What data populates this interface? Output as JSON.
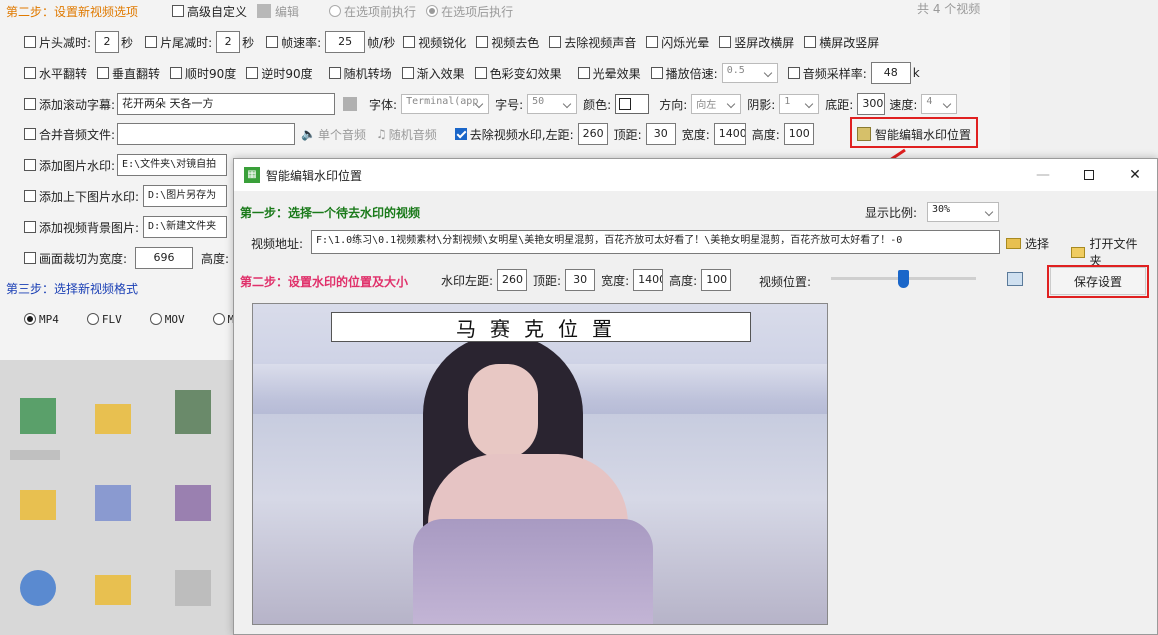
{
  "back": {
    "step2_title": "第二步：设置新视频选项",
    "advanced_custom": "高级自定义",
    "edit_label": "编辑",
    "before_opt": "在选项前执行",
    "after_opt": "在选项后执行",
    "count_text": "共 4 个视频",
    "row1": {
      "head_cut": "片头减时:",
      "head_val": "2",
      "sec1": "秒",
      "tail_cut": "片尾减时:",
      "tail_val": "2",
      "sec2": "秒",
      "fps": "帧速率:",
      "fps_val": "25",
      "fps_unit": "帧/秒",
      "sharpen": "视频锐化",
      "decolor": "视频去色",
      "mute": "去除视频声音",
      "flash": "闪烁光晕",
      "v2h": "竖屏改横屏",
      "h2v": "横屏改竖屏"
    },
    "row2": {
      "hflip": "水平翻转",
      "vflip": "垂直翻转",
      "cw90": "顺时90度",
      "ccw90": "逆时90度",
      "random_trans": "随机转场",
      "fade_in": "渐入效果",
      "color_fx": "色彩变幻效果",
      "halo_fx": "光晕效果",
      "speed": "播放倍速:",
      "speed_val": "0.5",
      "sample_rate": "音频采样率:",
      "sample_val": "48",
      "sample_unit": "k"
    },
    "row3": {
      "scroll_sub": "添加滚动字幕:",
      "sub_text": "花开两朵 天各一方",
      "font_lbl": "字体:",
      "font_val": "Terminal(app",
      "size_lbl": "字号:",
      "size_val": "50",
      "color_lbl": "颜色:",
      "dir_lbl": "方向:",
      "dir_val": "向左",
      "shadow_lbl": "阴影:",
      "shadow_val": "1",
      "bottom_lbl": "底距:",
      "bottom_val": "300",
      "speed_lbl": "速度:",
      "speed_val": "4"
    },
    "row4": {
      "merge_audio": "合并音频文件:",
      "single_audio": "单个音频",
      "random_audio": "随机音频",
      "remove_wm": "去除视频水印,左距:",
      "left_val": "260",
      "top_lbl": "顶距:",
      "top_val": "30",
      "width_lbl": "宽度:",
      "width_val": "1400",
      "height_lbl": "高度:",
      "height_val": "100",
      "smart_btn": "智能编辑水印位置"
    },
    "row5": {
      "img_wm": "添加图片水印:",
      "path": "E:\\文件夹\\对镜自拍"
    },
    "row6": {
      "tb_wm": "添加上下图片水印:",
      "path": "D:\\图片另存为"
    },
    "row7": {
      "bg_img": "添加视频背景图片:",
      "path": "D:\\新建文件夹"
    },
    "row8": {
      "crop": "画面裁切为宽度:",
      "crop_w": "696",
      "crop_h_lbl": "高度:"
    },
    "step3_title": "第三步：选择新视频格式",
    "formats": [
      "MP4",
      "FLV",
      "MOV",
      "M"
    ]
  },
  "dialog": {
    "title": "智能编辑水印位置",
    "step1": "第一步：选择一个待去水印的视频",
    "ratio_lbl": "显示比例:",
    "ratio_val": "30%",
    "addr_lbl": "视频地址:",
    "addr_val": "F:\\1.0练习\\0.1视频素材\\分割视频\\女明星\\美艳女明星混剪，百花齐放可太好看了！\\美艳女明星混剪，百花齐放可太好看了！-0",
    "choose_btn": "选择",
    "open_folder_btn": "打开文件夹",
    "step2": "第二步：设置水印的位置及大小",
    "wm_left_lbl": "水印左距:",
    "wm_left_val": "260",
    "wm_top_lbl": "顶距:",
    "wm_top_val": "30",
    "wm_width_lbl": "宽度:",
    "wm_width_val": "1400",
    "wm_height_lbl": "高度:",
    "wm_height_val": "100",
    "video_pos_lbl": "视频位置:",
    "video_pos": 0.5,
    "save_btn": "保存设置",
    "mosaic_text": "马赛克位置"
  },
  "colors": {
    "accent_red": "#e02020",
    "step_green": "#1a7a1a",
    "step_pink": "#e0306a",
    "step_orange": "#e07a00",
    "blue": "#1a66c9"
  }
}
